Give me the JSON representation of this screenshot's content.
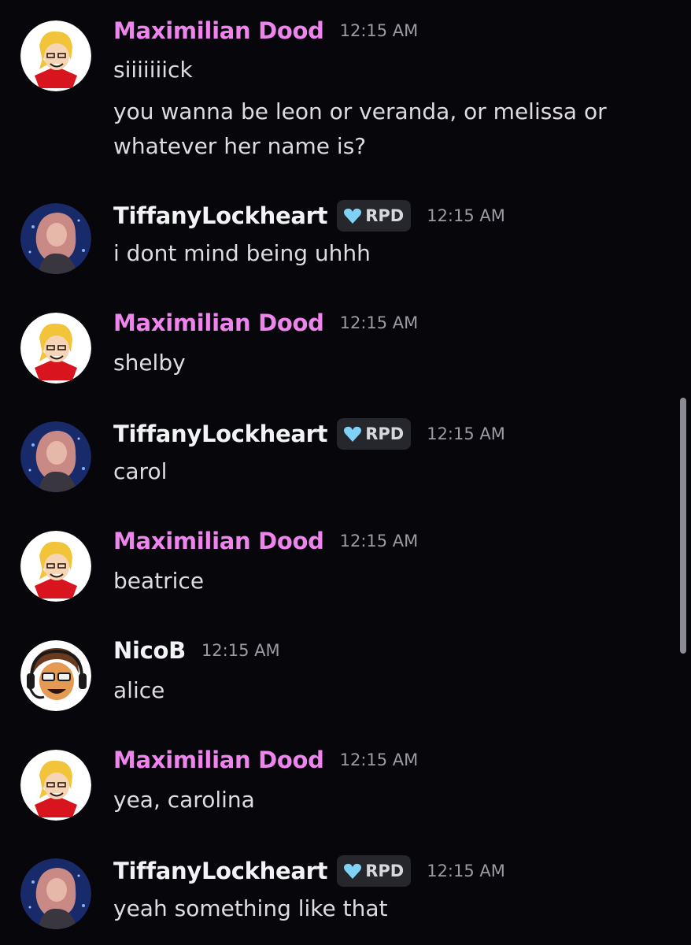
{
  "messages": [
    {
      "author": "Maximilian Dood",
      "timestamp": "12:15 AM",
      "lines": [
        "siiiiiiick",
        "you wanna be leon or veranda, or melissa or",
        "whatever her name is?"
      ]
    },
    {
      "author": "TiffanyLockheart",
      "tag": "RPD",
      "timestamp": "12:15 AM",
      "lines": [
        "i dont mind being uhhh"
      ]
    },
    {
      "author": "Maximilian Dood",
      "timestamp": "12:15 AM",
      "lines": [
        "shelby"
      ]
    },
    {
      "author": "TiffanyLockheart",
      "tag": "RPD",
      "timestamp": "12:15 AM",
      "lines": [
        "carol"
      ]
    },
    {
      "author": "Maximilian Dood",
      "timestamp": "12:15 AM",
      "lines": [
        "beatrice"
      ]
    },
    {
      "author": "NicoB",
      "timestamp": "12:15 AM",
      "lines": [
        "alice"
      ]
    },
    {
      "author": "Maximilian Dood",
      "timestamp": "12:15 AM",
      "lines": [
        "yea, carolina"
      ]
    },
    {
      "author": "TiffanyLockheart",
      "tag": "RPD",
      "timestamp": "12:15 AM",
      "lines": [
        "yeah something like that"
      ]
    }
  ],
  "colors": {
    "background": "#06060b",
    "maximilian_name": "#f084ee",
    "tag_background": "#26272d",
    "tag_icon": "#7fd2f5"
  },
  "icons": {
    "tag_icon": "heart-icon"
  }
}
